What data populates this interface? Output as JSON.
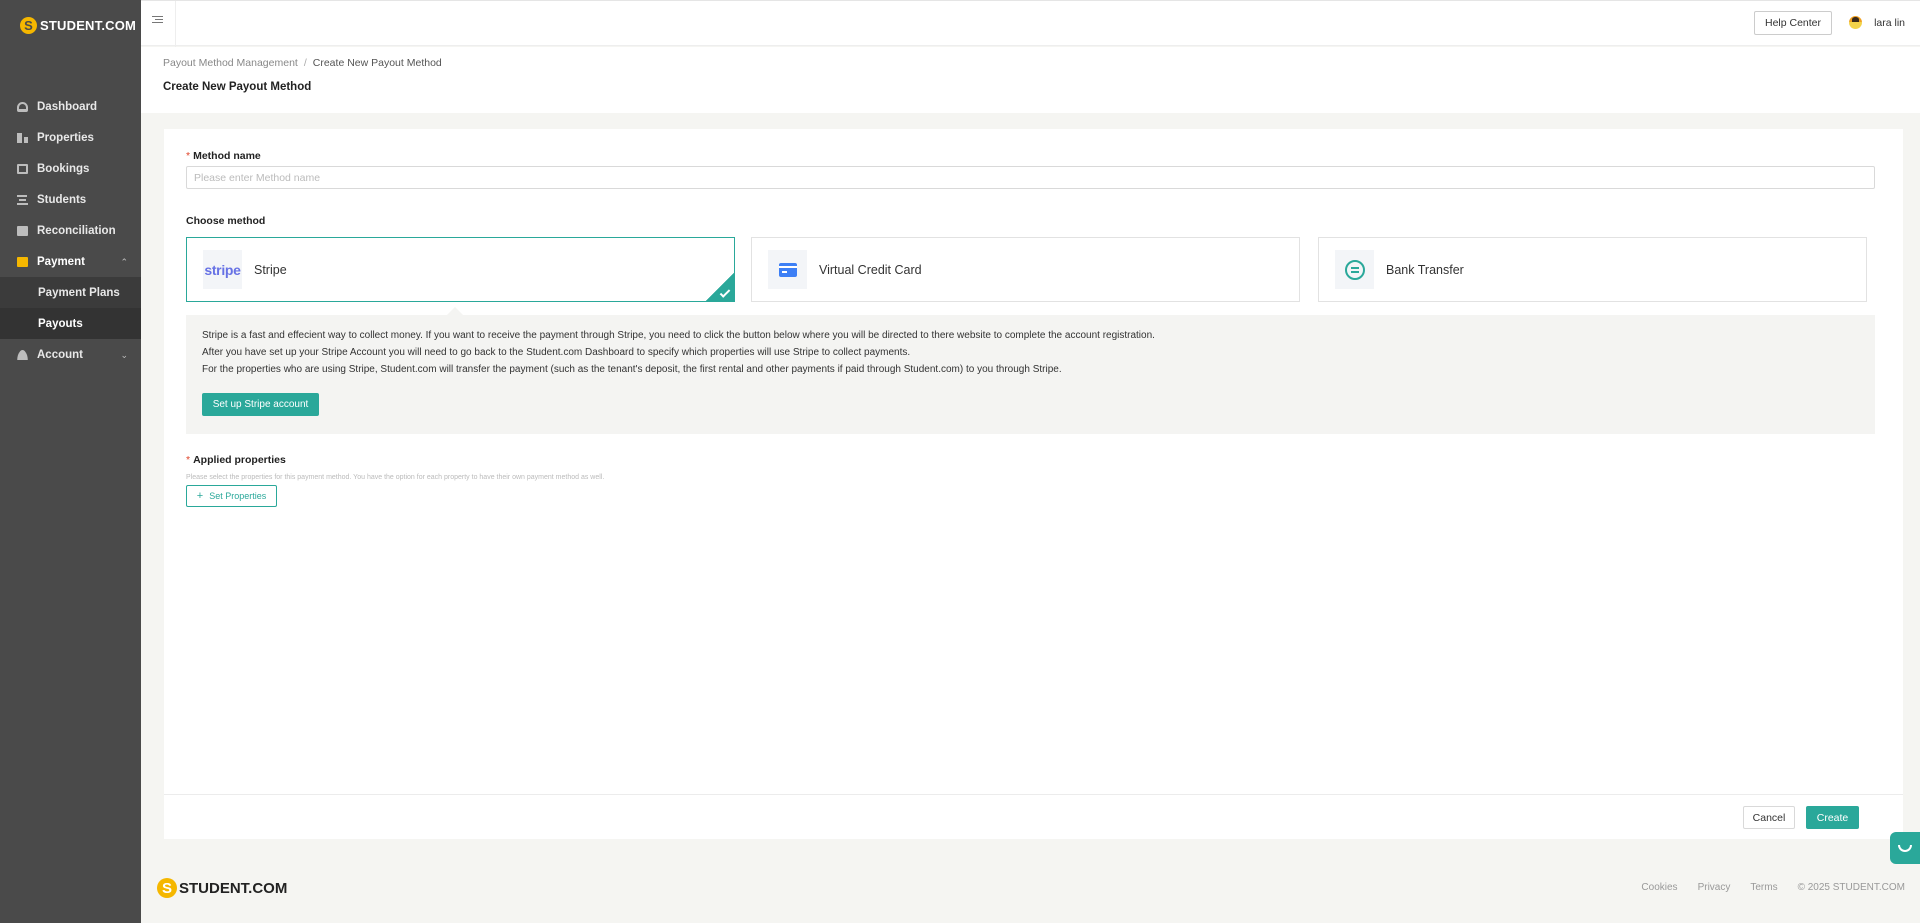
{
  "brand": {
    "logo_text": "STUDENT.COM",
    "logo_mark": "S",
    "accent": "#2aa89a",
    "brand_yellow": "#f5b700"
  },
  "sidebar": {
    "items": [
      {
        "label": "Dashboard",
        "icon": "dashboard-icon"
      },
      {
        "label": "Properties",
        "icon": "building-icon"
      },
      {
        "label": "Bookings",
        "icon": "calendar-icon"
      },
      {
        "label": "Students",
        "icon": "users-icon"
      },
      {
        "label": "Reconciliation",
        "icon": "dollar-icon"
      },
      {
        "label": "Payment",
        "icon": "wallet-icon",
        "expanded": true,
        "children": [
          {
            "label": "Payment Plans"
          },
          {
            "label": "Payouts",
            "selected": true
          }
        ]
      },
      {
        "label": "Account",
        "icon": "user-icon",
        "expanded": false
      }
    ],
    "chevron_up": "⌃",
    "chevron_down": "⌄"
  },
  "topbar": {
    "help_label": "Help Center",
    "user_name": "lara lin"
  },
  "header": {
    "breadcrumb": [
      "Payout Method Management",
      "Create New Payout Method"
    ],
    "breadcrumb_sep": "/",
    "title": "Create New Payout Method"
  },
  "form": {
    "required_mark": "*",
    "method_name_label": "Method name",
    "method_name_value": "",
    "method_name_placeholder": "Please enter Method name",
    "choose_method_label": "Choose method",
    "methods": [
      {
        "name": "Stripe",
        "logo_text": "stripe",
        "selected": true
      },
      {
        "name": "Virtual Credit Card",
        "selected": false
      },
      {
        "name": "Bank Transfer",
        "selected": false
      }
    ],
    "stripe_info": [
      "Stripe is a fast and effecient way to collect money. If you want to receive the payment through Stripe, you need to click the button below where you will be directed to there website to complete the account registration.",
      "After you have set up your Stripe Account you will need to go back to the Student.com Dashboard to specify which properties will use Stripe to collect payments.",
      "For the properties who are using Stripe, Student.com will transfer the payment (such as the tenant's deposit, the first rental and other payments if paid through Student.com) to you through Stripe."
    ],
    "setup_stripe_label": "Set up Stripe account",
    "applied_properties_label": "Applied properties",
    "applied_properties_hint": "Please select the properties for this payment method. You have the option for each property to have their own payment method as well.",
    "set_properties_label": "Set Properties",
    "set_properties_plus": "+",
    "cancel_label": "Cancel",
    "create_label": "Create"
  },
  "footer": {
    "logo_text": "STUDENT.COM",
    "links": [
      "Cookies",
      "Privacy",
      "Terms"
    ],
    "copyright": "© 2025 STUDENT.COM"
  }
}
